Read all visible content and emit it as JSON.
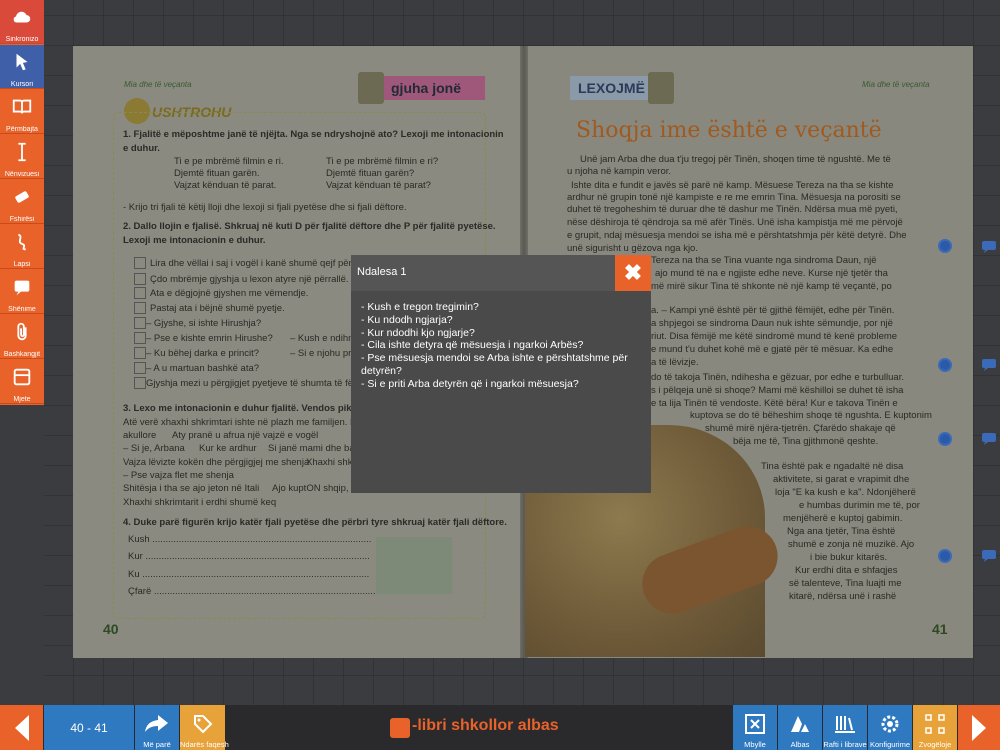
{
  "sidebar": {
    "items": [
      {
        "label": "Sinkronizo",
        "icon": "cloud-icon"
      },
      {
        "label": "Kursori",
        "icon": "cursor-icon"
      },
      {
        "label": "Përmbajta",
        "icon": "book-icon"
      },
      {
        "label": "Nënvizuesi",
        "icon": "text-cursor-icon"
      },
      {
        "label": "Fshirësi",
        "icon": "eraser-icon"
      },
      {
        "label": "Lapsi",
        "icon": "pencil-icon"
      },
      {
        "label": "Shënime",
        "icon": "notes-icon"
      },
      {
        "label": "Bashkangjit",
        "icon": "paperclip-icon"
      },
      {
        "label": "Mjete",
        "icon": "tools-icon"
      }
    ]
  },
  "book": {
    "left": {
      "mini_header": "Mia dhe të veçanta",
      "banner": "gjuha jonë",
      "ushtrohu": "USHTROHU",
      "lines": [
        "1. Fjalitë e mëposhtme janë të njëjta. Nga se ndryshojnë ato? Lexoji me intonacionin",
        "e duhur.",
        "Ti e pe mbrëmë filmin e ri.",
        "Ti e pe mbrëmë filmin e ri?",
        "Djemtë fituan garën.",
        "Djemtë fituan garën?",
        "Vajzat kënduan të parat.",
        "Vajzat kënduan të parat?",
        "- Krijo tri fjali të këtij lloji dhe lexoji si fjali pyetëse dhe si fjali dëftore.",
        "2. Dallo llojin e fjalisë. Shkruaj në kuti D për fjalitë dëftore dhe P për fjalitë pyetëse.",
        "Lexoji me intonacionin e duhur.",
        "Lira dhe vëllai i saj i vogël i kanë shumë qejf përrallat",
        "Çdo mbrëmje gjyshja u lexon atyre një përrallë.",
        "Ata e dëgjojnë gjyshen me vëmendje.",
        "Pastaj ata i bëjnë shumë pyetje.",
        "– Gjyshe, si ishte Hirushja?",
        "– Pse e kishte emrin Hirushe?",
        "– Kush e ndihm",
        "– Ku bëhej darka e princit?",
        "– Si e njohu pri",
        "– A u martuan bashkë ata?",
        "Gjyshja mezi u përgjigjet pyetjeve të shumta të fëm",
        "3. Lexo me intonacionin e duhur fjalitë. Vendos pikë (.) os",
        "Atë verë xhaxhi shkrimtari ishte në plazh me familjen. Nj",
        "akullore",
        "Aty pranë u afrua një vajzë e vogël",
        "– Si je, Arbana",
        "Kur ke ardhur",
        "Si janë mami dhe ba",
        "Vajza lëvizte kokën dhe përgjigjej me shenja",
        "Xhaxhi shkri",
        "– Pse vajza flet me shenja",
        "Shitësja i tha se ajo jeton në Itali",
        "Ajo kuptON shqip, p",
        "Xhaxhi shkrimtarit i erdhi shumë keq",
        "4. Duke parë figurën krijo katër fjali pyetëse dhe përbri tyre shkruaj katër fjali dëftore.",
        "Kush ...................................................................................",
        "Kur .....................................................................................",
        "Ku ......................................................................................",
        "Çfarë ...................................................................................."
      ],
      "page_number": "40"
    },
    "right": {
      "mini_header": "Mia dhe të veçanta",
      "banner": "LEXOJMË",
      "title": "Shoqja ime është e veçantë",
      "lines": [
        "Unë jam Arba dhe dua t'ju tregoj për Tinën, shoqen time të ngushtë. Me të",
        "u njoha në kampin veror.",
        "Ishte dita e fundit e javës së parë në kamp. Mësuese Tereza na tha se kishte",
        "ardhur në grupin tonë një kampiste e re me emrin Tina. Mësuesja na porositi se",
        "duhet të tregoheshim të duruar dhe të dashur me Tinën. Ndërsa mua më pyeti,",
        "nëse dëshiroja të qëndroja sa më afër Tinës. Unë isha kampistja më me përvojë",
        "e grupit, ndaj mësuesja mendoi se isha më e përshtatshmja për këtë detyrë. Dhe",
        "unë sigurisht u gëzova nga kjo.",
        "Tereza na tha se Tina vuante nga sindroma Daun, një",
        "ajo mund të na e ngjiste edhe neve. Kurse një tjetër tha",
        "më mirë sikur Tina të shkonte në një kamp të veçantë, po",
        "a. – Kampi ynë është për të gjithë fëmijët, edhe për Tinën.",
        "a shpjegoi se sindroma Daun nuk ishte sëmundje, por një",
        "riut. Disa fëmijë me këtë sindromë mund të kenë probleme",
        "e mund t'u duhet kohë më e gjatë për të mësuar. Ka edhe",
        "a të lëvizje.",
        "do të takoja Tinën, ndihesha e gëzuar, por edhe e turbulluar.",
        "s i pëlqeja unë si shoqe? Mami më këshilloi se duhet të isha",
        "e ta lija Tinën të vendoste. Këtë bëra! Kur e takova Tinën e",
        "kuptova se do të bëheshim shoqe të ngushta. E kuptonim",
        "shumë mirë njëra-tjetrën. Çfarëdo shakaje që",
        "bëja me të, Tina gjithmonë qeshte.",
        "Tina është pak e ngadaltë në disa",
        "aktivitete, si garat e vrapimit dhe",
        "loja \"E ka kush e ka\". Ndonjëherë",
        "e humbas durimin me të, por",
        "menjëherë e kuptoj gabimin.",
        "Nga ana tjetër, Tina është",
        "shumë e zonja në muzikë. Ajo",
        "i bie bukur kitarës.",
        "Kur erdhi dita e shfaqjes",
        "së talenteve, Tina luajti me",
        "kitarë, ndërsa unë i rashë"
      ],
      "page_number": "41"
    }
  },
  "modal": {
    "title": "Ndalesa 1",
    "close_label": "✖",
    "questions": [
      "- Kush e tregon tregimin?",
      "- Ku ndodh ngjarja?",
      "- Kur ndodhi kjo ngjarje?",
      "- Cila ishte detyra që mësuesja i ngarkoi Arbës?",
      "- Pse mësuesja mendoi se Arba ishte e përshtatshme për detyrën?",
      "- Si e priti Arba detyrën që i ngarkoi mësuesja?"
    ]
  },
  "bottombar": {
    "page_range": "40 - 41",
    "back_label": "Më parë",
    "bookmark_label": "Ndarës faqesh",
    "brand": "-libri shkollor albas",
    "close_label": "Mbylle",
    "albas_label": "Albas",
    "library_label": "Rafti i librave",
    "config_label": "Konfigurime",
    "zoom_label": "Zvogëloje"
  }
}
